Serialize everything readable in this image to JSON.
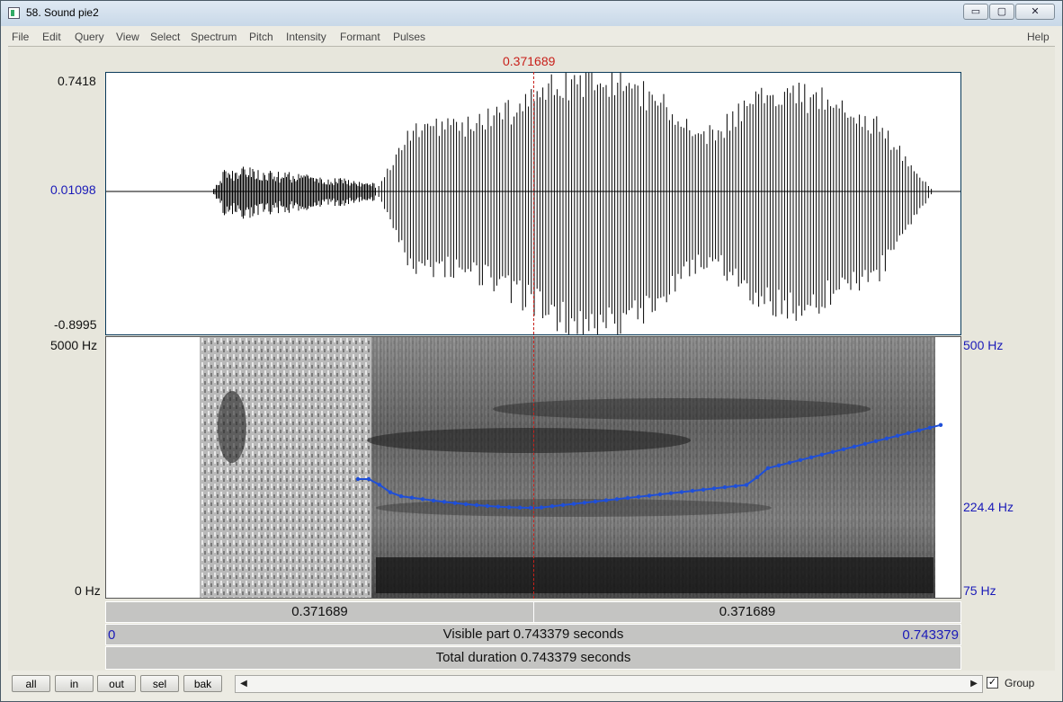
{
  "window": {
    "title": "58. Sound pie2",
    "min_glyph": "▭",
    "max_glyph": "▢",
    "close_glyph": "✕"
  },
  "menu": {
    "items": [
      "File",
      "Edit",
      "Query",
      "View",
      "Select",
      "Spectrum",
      "Pitch",
      "Intensity",
      "Formant",
      "Pulses"
    ],
    "help": "Help"
  },
  "cursor_time": "0.371689",
  "waveform": {
    "max": "0.7418",
    "mid": "0.01098",
    "min": "-0.8995"
  },
  "spectrogram": {
    "left_top": "5000 Hz",
    "left_bottom": "0 Hz",
    "right_top": "500 Hz",
    "right_mid": "224.4 Hz",
    "right_bottom": "75 Hz"
  },
  "time_bar": {
    "left_segment": "0.371689",
    "right_segment": "0.371689"
  },
  "visible_bar": {
    "start": "0",
    "label": "Visible part 0.743379 seconds",
    "end": "0.743379"
  },
  "total_bar": {
    "label": "Total duration 0.743379 seconds"
  },
  "buttons": [
    "all",
    "in",
    "out",
    "sel",
    "bak"
  ],
  "scroll": {
    "left_arrow": "◀",
    "right_arrow": "▶"
  },
  "group": {
    "label": "Group",
    "checked": true,
    "mark": "✓"
  },
  "colors": {
    "cursor": "#c8201a",
    "axis_blue": "#1a1ab8",
    "pitch": "#1f4fd8"
  }
}
